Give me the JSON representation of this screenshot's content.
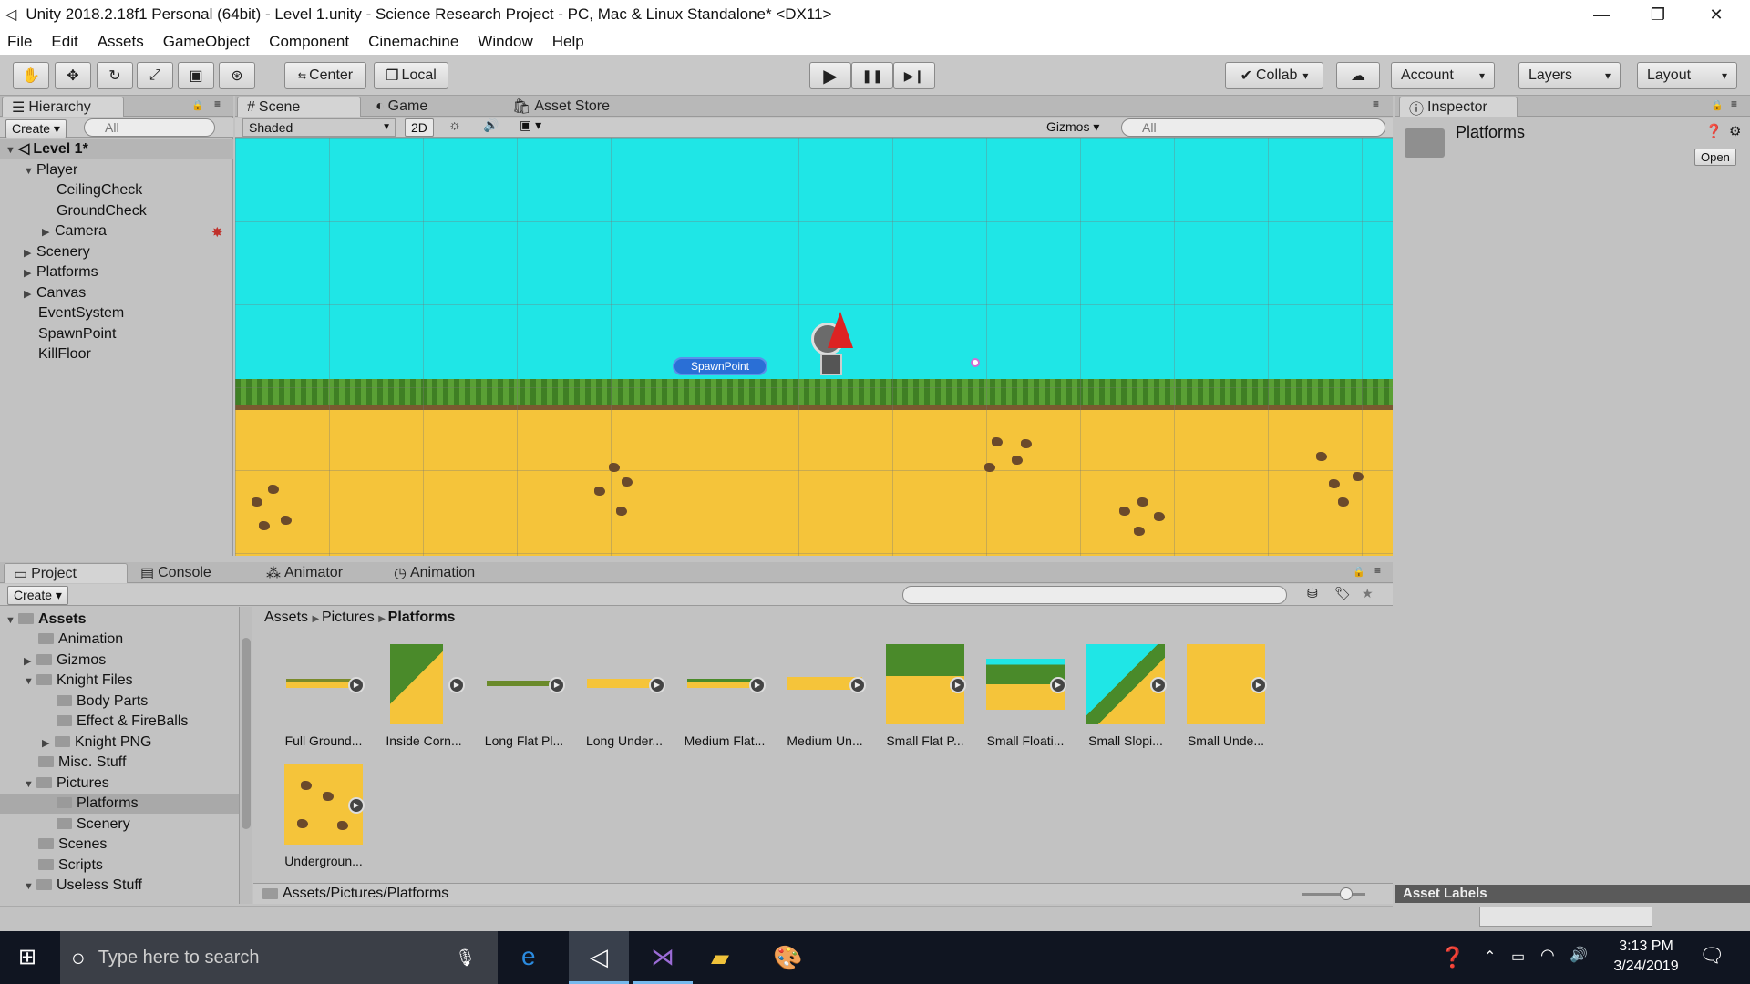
{
  "window": {
    "title": "Unity 2018.2.18f1 Personal (64bit) - Level 1.unity - Science Research Project - PC, Mac & Linux Standalone* <DX11>",
    "minimize": "—",
    "restore": "❐",
    "close": "✕"
  },
  "menu": [
    "File",
    "Edit",
    "Assets",
    "GameObject",
    "Component",
    "Cinemachine",
    "Window",
    "Help"
  ],
  "toolbar": {
    "center": "Center",
    "local": "Local",
    "play": "▶",
    "pause": "❚❚",
    "step": "▶❙",
    "collab": "Collab",
    "account": "Account",
    "layers": "Layers",
    "layout": "Layout",
    "dropdown": "▾"
  },
  "hierarchy": {
    "tab": "Hierarchy",
    "create": "Create",
    "search_placeholder": "All",
    "scene": "Level 1*",
    "items": [
      {
        "label": "Player",
        "expanded": true
      },
      {
        "label": "CeilingCheck"
      },
      {
        "label": "GroundCheck"
      },
      {
        "label": "Camera",
        "collapsed": true
      },
      {
        "label": "Scenery",
        "collapsed": true
      },
      {
        "label": "Platforms",
        "collapsed": true
      },
      {
        "label": "Canvas",
        "collapsed": true
      },
      {
        "label": "EventSystem"
      },
      {
        "label": "SpawnPoint"
      },
      {
        "label": "KillFloor"
      }
    ]
  },
  "scene": {
    "tabs": [
      "Scene",
      "Game",
      "Asset Store"
    ],
    "shading": "Shaded",
    "mode_2d": "2D",
    "gizmos": "Gizmos",
    "search_placeholder": "All",
    "spawn_label": "SpawnPoint",
    "sky_color": "#1fe6e6",
    "ground_color": "#f5c43a",
    "grass_color": "#4a8a2a"
  },
  "inspector": {
    "tab": "Inspector",
    "object_name": "Platforms",
    "open_button": "Open",
    "asset_labels": "Asset Labels"
  },
  "project": {
    "tabs": [
      "Project",
      "Console",
      "Animator",
      "Animation"
    ],
    "create": "Create",
    "tree": [
      {
        "label": "Assets",
        "bold": true
      },
      {
        "label": "Animation"
      },
      {
        "label": "Gizmos"
      },
      {
        "label": "Knight Files"
      },
      {
        "label": "Body Parts"
      },
      {
        "label": "Effect & FireBalls"
      },
      {
        "label": "Knight PNG"
      },
      {
        "label": "Misc. Stuff"
      },
      {
        "label": "Pictures"
      },
      {
        "label": "Platforms",
        "selected": true
      },
      {
        "label": "Scenery"
      },
      {
        "label": "Scenes"
      },
      {
        "label": "Scripts"
      },
      {
        "label": "Useless Stuff"
      }
    ],
    "breadcrumb": [
      "Assets",
      "Pictures",
      "Platforms"
    ],
    "assets": [
      "Full Ground...",
      "Inside Corn...",
      "Long Flat Pl...",
      "Long Under...",
      "Medium Flat...",
      "Medium Un...",
      "Small Flat P...",
      "Small Floati...",
      "Small Slopi...",
      "Small Unde...",
      "Undergroun..."
    ],
    "path": "Assets/Pictures/Platforms"
  },
  "taskbar": {
    "search_placeholder": "Type here to search",
    "time": "3:13 PM",
    "date": "3/24/2019"
  }
}
